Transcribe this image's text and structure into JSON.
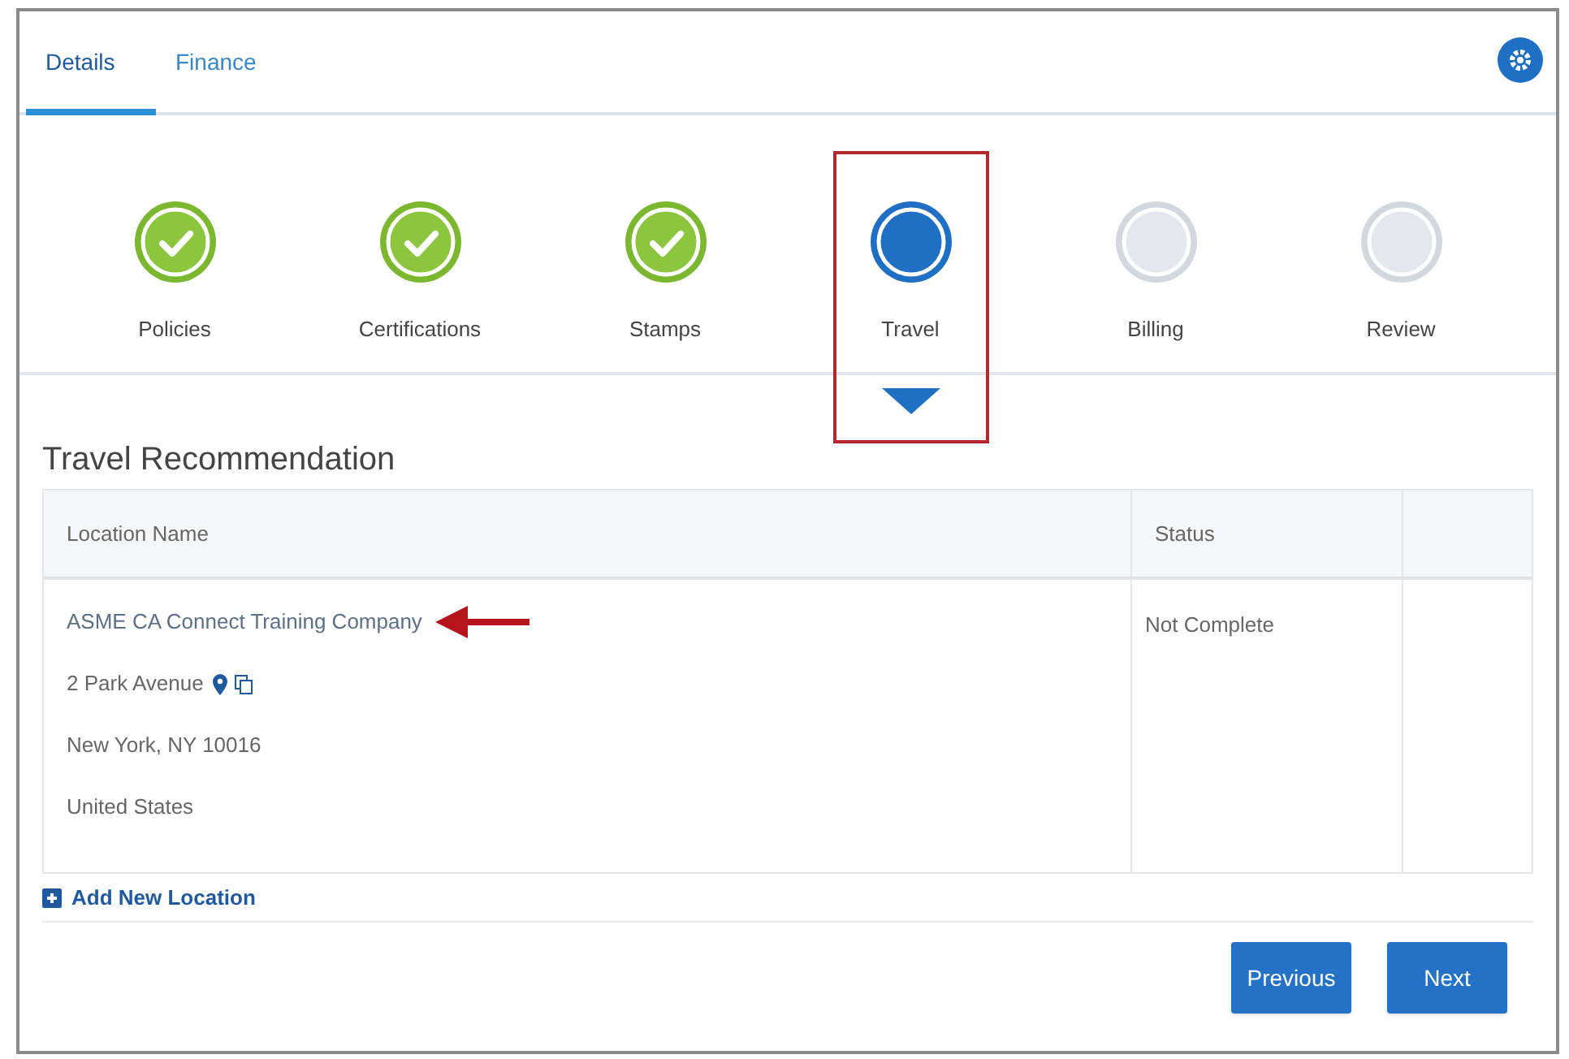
{
  "tabs": [
    {
      "label": "Details",
      "selected": true
    },
    {
      "label": "Finance",
      "selected": false
    }
  ],
  "steps": [
    {
      "label": "Policies",
      "kind": "complete",
      "highlighted": false
    },
    {
      "label": "Certifications",
      "kind": "complete",
      "highlighted": false
    },
    {
      "label": "Stamps",
      "kind": "complete",
      "highlighted": false
    },
    {
      "label": "Travel",
      "kind": "current",
      "highlighted": true
    },
    {
      "label": "Billing",
      "kind": "pending",
      "highlighted": false
    },
    {
      "label": "Review",
      "kind": "pending",
      "highlighted": false
    }
  ],
  "section_title": "Travel Recommendation",
  "table": {
    "columns": [
      "Location Name",
      "Status"
    ],
    "rows": [
      {
        "name": "ASME CA Connect Training Company",
        "arrow": true,
        "address": [
          "2 Park Avenue",
          "New York, NY 10016",
          "United States"
        ],
        "status": "Not Complete"
      }
    ]
  },
  "add_link": "Add New Location",
  "buttons": [
    "Previous",
    "Next"
  ]
}
